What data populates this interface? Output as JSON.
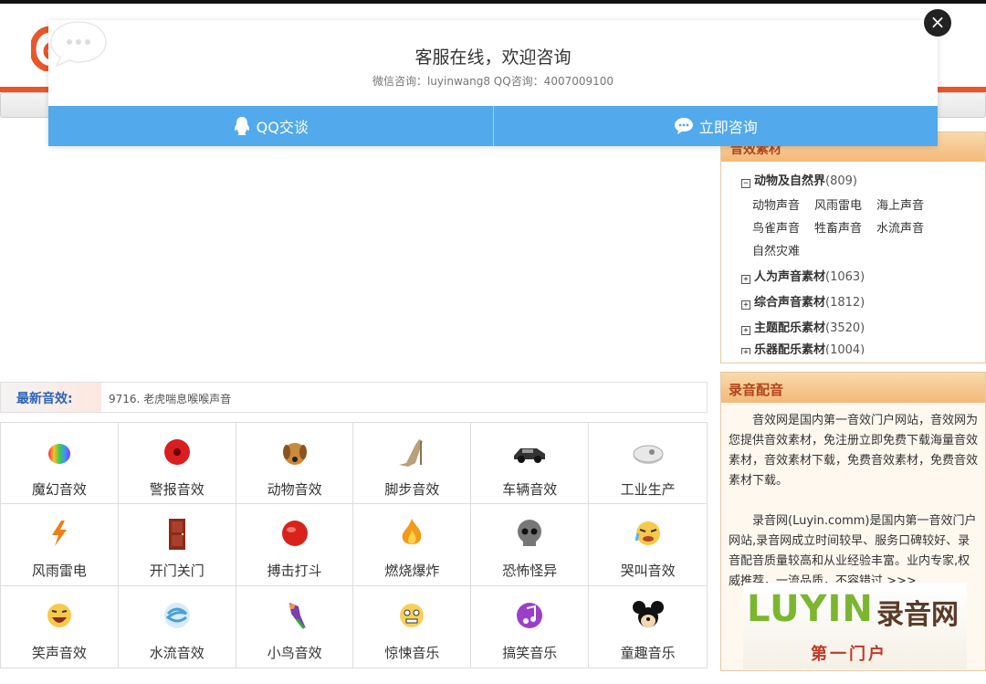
{
  "popup": {
    "title": "客服在线，欢迎咨询",
    "contact": "微信咨询：luyinwang8 QQ咨询：4007009100",
    "qq_button": "QQ交谈",
    "consult_button": "立即咨询",
    "close_icon": "×"
  },
  "sidebar": {
    "category_title": "音效素材",
    "expanded": {
      "name": "动物及自然界",
      "count": "(809)",
      "toggle": "−",
      "children": [
        "动物声音",
        "风雨雷电",
        "海上声音",
        "鸟雀声音",
        "牲畜声音",
        "水流声音",
        "自然灾难"
      ]
    },
    "collapsed": [
      {
        "name": "人为声音素材",
        "count": "(1063)",
        "toggle": "+"
      },
      {
        "name": "综合声音素材",
        "count": "(1812)",
        "toggle": "+"
      },
      {
        "name": "主题配乐素材",
        "count": "(3520)",
        "toggle": "+"
      },
      {
        "name": "乐器配乐素材",
        "count": "(1004)",
        "toggle": "+"
      }
    ],
    "luyin_title": "录音配音",
    "luyin_para1": "音效网是国内第一音效门户网站，音效网为您提供音效素材，免注册立即免费下载海量音效素材，音效素材下载，免费音效素材，免费音效素材下载。",
    "luyin_para2": "录音网(Luyin.comm)是国内第一音效门户网站,录音网成立时间较早、服务口碑较好、录音配音质量较高和从业经验丰富。业内专家,权威推荐，一流品质，不容错过 >>>",
    "logo_main": "LUYIN",
    "logo_cn": "录音网",
    "logo_sub": "第一门户"
  },
  "latest": {
    "label": "最新音效:",
    "item": "9716. 老虎喘息喉喉声音"
  },
  "categories": [
    {
      "label": "魔幻音效",
      "icon": "rainbow-orb-icon"
    },
    {
      "label": "警报音效",
      "icon": "alarm-button-icon"
    },
    {
      "label": "动物音效",
      "icon": "dog-icon"
    },
    {
      "label": "脚步音效",
      "icon": "high-heel-icon"
    },
    {
      "label": "车辆音效",
      "icon": "sports-car-icon"
    },
    {
      "label": "工业生产",
      "icon": "machine-disc-icon"
    },
    {
      "label": "风雨雷电",
      "icon": "lightning-icon"
    },
    {
      "label": "开门关门",
      "icon": "door-icon"
    },
    {
      "label": "搏击打斗",
      "icon": "boxing-glove-icon"
    },
    {
      "label": "燃烧爆炸",
      "icon": "fire-icon"
    },
    {
      "label": "恐怖怪异",
      "icon": "skull-icon"
    },
    {
      "label": "哭叫音效",
      "icon": "crying-face-icon"
    },
    {
      "label": "笑声音效",
      "icon": "laughing-face-icon"
    },
    {
      "label": "水流音效",
      "icon": "water-swirl-icon"
    },
    {
      "label": "小鸟音效",
      "icon": "parrot-icon"
    },
    {
      "label": "惊悚音乐",
      "icon": "scared-face-icon"
    },
    {
      "label": "搞笑音乐",
      "icon": "purple-music-icon"
    },
    {
      "label": "童趣音乐",
      "icon": "mickey-icon"
    }
  ],
  "colors": {
    "accent_blue": "#52a9ec",
    "header_orange": "#e8572a",
    "panel_title": "#b1451a",
    "latest_label": "#2f63b7"
  }
}
